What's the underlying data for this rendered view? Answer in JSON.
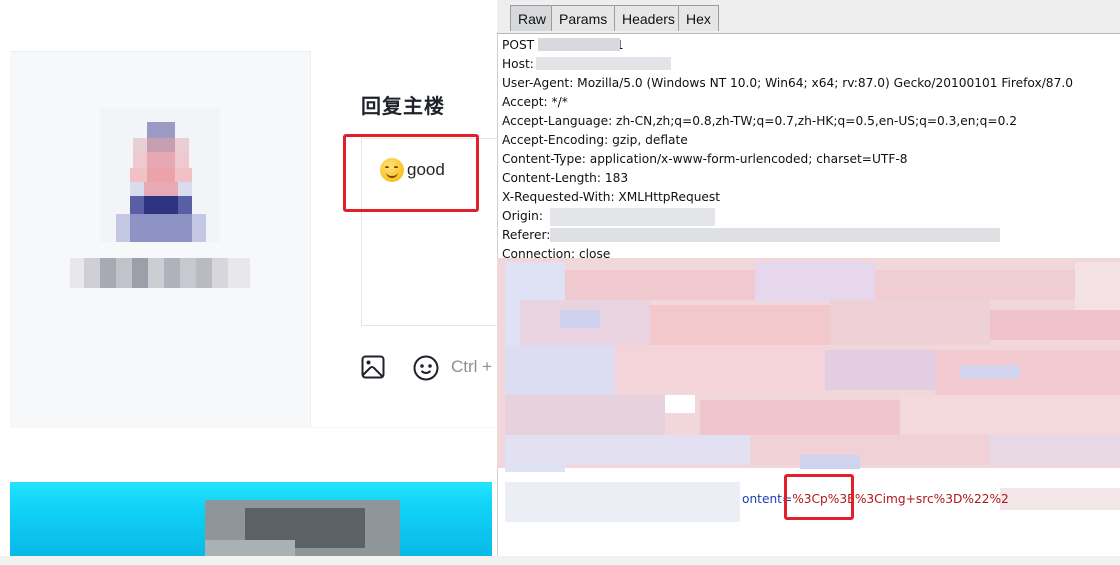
{
  "forum": {
    "reply_title": "回复主楼",
    "editor_text": "good",
    "toolbar_hint": "Ctrl +"
  },
  "burp": {
    "tabs": [
      "Raw",
      "Params",
      "Headers",
      "Hex"
    ],
    "active_tab": "Raw",
    "request_lines": [
      {
        "key": "post",
        "text": "POST                /add HTTP/1.1"
      },
      {
        "key": "host",
        "text": "Host:"
      },
      {
        "key": "ua",
        "text": "User-Agent: Mozilla/5.0 (Windows NT 10.0; Win64; x64; rv:87.0) Gecko/20100101 Firefox/87.0"
      },
      {
        "key": "accept",
        "text": "Accept: */*"
      },
      {
        "key": "lang",
        "text": "Accept-Language: zh-CN,zh;q=0.8,zh-TW;q=0.7,zh-HK;q=0.5,en-US;q=0.3,en;q=0.2"
      },
      {
        "key": "enc",
        "text": "Accept-Encoding: gzip, deflate"
      },
      {
        "key": "ctype",
        "text": "Content-Type: application/x-www-form-urlencoded; charset=UTF-8"
      },
      {
        "key": "clen",
        "text": "Content-Length: 183"
      },
      {
        "key": "xrw",
        "text": "X-Requested-With: XMLHttpRequest"
      },
      {
        "key": "origin",
        "text": "Origin:"
      },
      {
        "key": "referer",
        "text": "Referer:"
      },
      {
        "key": "conn",
        "text": "Connection: close"
      }
    ],
    "body_key": "ontent=",
    "body_highlight": "%3Cp%3E",
    "body_rest": "%3Cimg+src%3D%22%2"
  },
  "colors": {
    "highlight": "#e0202a",
    "body_value": "#b0171b",
    "body_key": "#1d3fb3"
  },
  "icons": [
    "image-icon",
    "emoji-icon",
    "smiley-emoji-icon"
  ]
}
